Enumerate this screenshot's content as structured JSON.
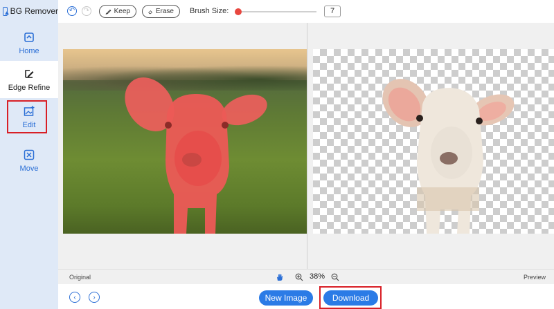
{
  "app": {
    "title": "BG Remover"
  },
  "sidebar": {
    "items": [
      {
        "label": "Home",
        "icon": "home-icon"
      },
      {
        "label": "Edge Refine",
        "icon": "edit-pen-icon"
      },
      {
        "label": "Edit",
        "icon": "image-edit-icon"
      },
      {
        "label": "Move",
        "icon": "move-arrows-icon"
      }
    ],
    "active_index": 1,
    "highlighted_index": 2
  },
  "toolbar": {
    "keep_label": "Keep",
    "erase_label": "Erase",
    "brush_size_label": "Brush Size:",
    "brush_size_value": "7",
    "brush_slider_fraction": 0.02
  },
  "statusbar": {
    "original_label": "Original",
    "zoom_value": "38%",
    "preview_label": "Preview"
  },
  "footer": {
    "new_image_label": "New Image",
    "download_label": "Download"
  },
  "colors": {
    "accent": "#2b7be6",
    "highlight_box": "#d81f26",
    "brush_red": "#e8473f",
    "sidebar_bg": "#dfe9f7"
  }
}
